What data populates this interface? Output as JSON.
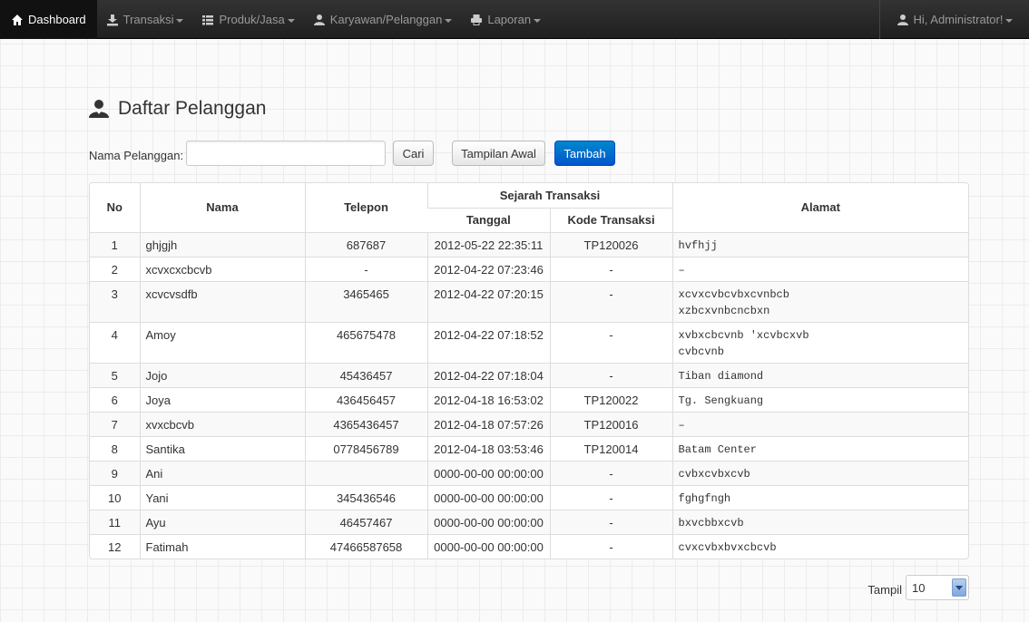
{
  "navbar": {
    "items": [
      {
        "label": "Dashboard",
        "active": true
      },
      {
        "label": "Transaksi"
      },
      {
        "label": "Produk/Jasa"
      },
      {
        "label": "Karyawan/Pelanggan"
      },
      {
        "label": "Laporan"
      }
    ],
    "user_label": "Hi, Administrator!"
  },
  "page": {
    "title": "Daftar Pelanggan"
  },
  "search": {
    "label": "Nama Pelanggan:",
    "value": "",
    "cari_label": "Cari",
    "reset_label": "Tampilan Awal",
    "add_label": "Tambah"
  },
  "table": {
    "headers": {
      "no": "No",
      "nama": "Nama",
      "telepon": "Telepon",
      "sejarah": "Sejarah Transaksi",
      "tanggal": "Tanggal",
      "kode": "Kode Transaksi",
      "alamat": "Alamat"
    },
    "rows": [
      {
        "no": "1",
        "nama": "ghjgjh",
        "telepon": "687687",
        "tanggal": "2012-05-22 22:35:11",
        "kode": "TP120026",
        "alamat": "hvfhjj"
      },
      {
        "no": "2",
        "nama": "xcvxcxcbcvb",
        "telepon": "-",
        "tanggal": "2012-04-22 07:23:46",
        "kode": "-",
        "alamat": "–"
      },
      {
        "no": "3",
        "nama": "xcvcvsdfb",
        "telepon": "3465465",
        "tanggal": "2012-04-22 07:20:15",
        "kode": "-",
        "alamat": "xcvxcvbcvbxcvnbcb\nxzbcxvnbcncbxn"
      },
      {
        "no": "4",
        "nama": "Amoy",
        "telepon": "465675478",
        "tanggal": "2012-04-22 07:18:52",
        "kode": "-",
        "alamat": "xvbxcbcvnb 'xcvbcxvb\ncvbcvnb"
      },
      {
        "no": "5",
        "nama": "Jojo",
        "telepon": "45436457",
        "tanggal": "2012-04-22 07:18:04",
        "kode": "-",
        "alamat": "Tiban diamond"
      },
      {
        "no": "6",
        "nama": "Joya",
        "telepon": "436456457",
        "tanggal": "2012-04-18 16:53:02",
        "kode": "TP120022",
        "alamat": "Tg. Sengkuang"
      },
      {
        "no": "7",
        "nama": "xvxcbcvb",
        "telepon": "4365436457",
        "tanggal": "2012-04-18 07:57:26",
        "kode": "TP120016",
        "alamat": "–"
      },
      {
        "no": "8",
        "nama": "Santika",
        "telepon": "0778456789",
        "tanggal": "2012-04-18 03:53:46",
        "kode": "TP120014",
        "alamat": "Batam Center"
      },
      {
        "no": "9",
        "nama": "Ani",
        "telepon": "",
        "tanggal": "0000-00-00 00:00:00",
        "kode": "-",
        "alamat": "cvbxcvbxcvb"
      },
      {
        "no": "10",
        "nama": "Yani",
        "telepon": "345436546",
        "tanggal": "0000-00-00 00:00:00",
        "kode": "-",
        "alamat": "fghgfngh"
      },
      {
        "no": "11",
        "nama": "Ayu",
        "telepon": "46457467",
        "tanggal": "0000-00-00 00:00:00",
        "kode": "-",
        "alamat": "bxvcbbxcvb"
      },
      {
        "no": "12",
        "nama": "Fatimah",
        "telepon": "47466587658",
        "tanggal": "0000-00-00 00:00:00",
        "kode": "-",
        "alamat": "cvxcvbxbvxcbcvb"
      }
    ]
  },
  "pagination": {
    "label": "Tampil",
    "selected": "10"
  },
  "icons": {
    "dashboard": "home-icon",
    "transaksi": "download-icon",
    "produk": "list-icon",
    "karyawan": "user-icon",
    "laporan": "print-icon",
    "user": "user-icon",
    "header": "user-silhouette-icon"
  },
  "colors": {
    "navbar": "#222222",
    "primary_button": "#0066cc"
  }
}
